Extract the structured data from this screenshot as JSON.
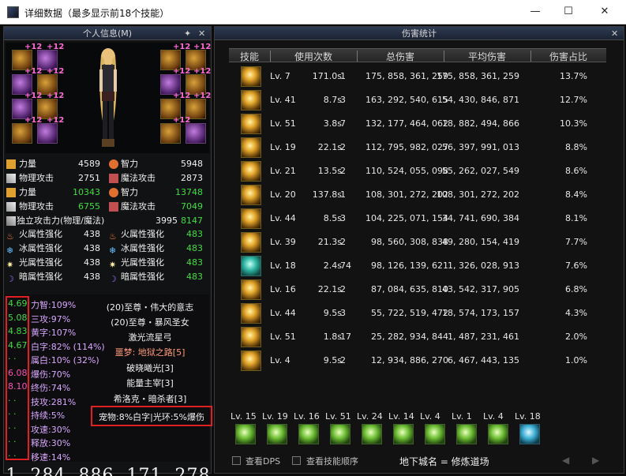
{
  "window": {
    "title": "详细数据（最多显示前18个技能）",
    "min": "—",
    "max": "☐",
    "close": "✕"
  },
  "left_panel": {
    "header": "个人信息(M)",
    "pin": "📌",
    "close": "✕",
    "equip_plus": "+12",
    "stats": [
      {
        "l1": "力量",
        "v1": "4589",
        "c1": "white",
        "l2": "智力",
        "v2": "5948",
        "c2": "white"
      },
      {
        "l1": "物理攻击",
        "v1": "2751",
        "c1": "white",
        "l2": "魔法攻击",
        "v2": "2873",
        "c2": "white"
      },
      {
        "l1": "力量",
        "v1": "10343",
        "c1": "green",
        "l2": "智力",
        "v2": "13748",
        "c2": "green"
      },
      {
        "l1": "物理攻击",
        "v1": "6755",
        "c1": "green",
        "l2": "魔法攻击",
        "v2": "7049",
        "c2": "green"
      }
    ],
    "indep": {
      "label": "独立攻击力(物理/魔法)",
      "v1": "3995",
      "v2": "8147"
    },
    "elements": [
      {
        "l1": "火属性强化",
        "v1": "438",
        "l2": "火属性强化",
        "v2": "483"
      },
      {
        "l1": "冰属性强化",
        "v1": "438",
        "l2": "冰属性强化",
        "v2": "483"
      },
      {
        "l1": "光属性强化",
        "v1": "438",
        "l2": "光属性强化",
        "v2": "483"
      },
      {
        "l1": "暗属性强化",
        "v1": "438",
        "l2": "暗属性强化",
        "v2": "483"
      }
    ],
    "buff_nums": [
      "4.69",
      "5.08",
      "4.83",
      "4.67",
      "· ·",
      "6.08",
      "8.10",
      "· ·",
      "· ·",
      "· ·",
      "· ·",
      "· ·"
    ],
    "buff_labels": [
      "力智:109%",
      "三攻:97%",
      "黄字:107%",
      "白字:82% (114%)",
      "属白:10% (32%)",
      "爆伤:70%",
      "终伤:74%",
      "技攻:281%",
      "持续:5%",
      "攻速:30%",
      "释放:30%",
      "移速:14%"
    ],
    "center_lines": [
      {
        "text": "(20)至尊・伟大的意志",
        "color": "#f0f0f0"
      },
      {
        "text": "(20)至尊・暴风圣女",
        "color": "#f0f0f0"
      },
      {
        "text": "激光流星弓",
        "color": "#f0f0f0"
      },
      {
        "text": "噩梦: 地狱之路[5]",
        "color": "#ff9a7a"
      },
      {
        "text": "破晓曦光[3]",
        "color": "#f0f0f0"
      },
      {
        "text": "能量主宰[3]",
        "color": "#f0f0f0"
      },
      {
        "text": "希洛克・暗杀者[3]",
        "color": "#f0f0f0"
      }
    ],
    "pet_line": "宠物:8%白字|光环:5%爆伤",
    "total_damage": "1, 284, 886, 171, 278"
  },
  "right_panel": {
    "header": "伤害统计",
    "close": "✕",
    "columns": [
      "技能",
      "使用次数",
      "总伤害",
      "平均伤害",
      "伤害占比"
    ],
    "rows": [
      {
        "lv": "Lv. 7",
        "time": "171.0s",
        "uses": "1",
        "total": "175, 858, 361, 259",
        "avg": "175, 858, 361, 259",
        "pct": "13.7%"
      },
      {
        "lv": "Lv. 41",
        "time": "8.7s",
        "uses": "3",
        "total": "163, 292, 540, 615",
        "avg": "54, 430, 846, 871",
        "pct": "12.7%"
      },
      {
        "lv": "Lv. 51",
        "time": "3.8s",
        "uses": "7",
        "total": "132, 177, 464, 062",
        "avg": "18, 882, 494, 866",
        "pct": "10.3%"
      },
      {
        "lv": "Lv. 19",
        "time": "22.1s",
        "uses": "2",
        "total": "112, 795, 982, 027",
        "avg": "56, 397, 991, 013",
        "pct": "8.8%"
      },
      {
        "lv": "Lv. 21",
        "time": "13.5s",
        "uses": "2",
        "total": "110, 524, 055, 098",
        "avg": "55, 262, 027, 549",
        "pct": "8.6%"
      },
      {
        "lv": "Lv. 20",
        "time": "137.8s",
        "uses": "1",
        "total": "108, 301, 272, 202",
        "avg": "108, 301, 272, 202",
        "pct": "8.4%"
      },
      {
        "lv": "Lv. 44",
        "time": "8.5s",
        "uses": "3",
        "total": "104, 225, 071, 154",
        "avg": "34, 741, 690, 384",
        "pct": "8.1%"
      },
      {
        "lv": "Lv. 39",
        "time": "21.3s",
        "uses": "2",
        "total": "98, 560, 308, 838",
        "avg": "49, 280, 154, 419",
        "pct": "7.7%"
      },
      {
        "lv": "Lv. 18",
        "time": "2.4s",
        "uses": "74",
        "total": "98, 126, 139, 621",
        "avg": "1, 326, 028, 913",
        "pct": "7.6%"
      },
      {
        "lv": "Lv. 16",
        "time": "22.1s",
        "uses": "2",
        "total": "87, 084, 635, 810",
        "avg": "43, 542, 317, 905",
        "pct": "6.8%"
      },
      {
        "lv": "Lv. 44",
        "time": "9.5s",
        "uses": "3",
        "total": "55, 722, 519, 472",
        "avg": "18, 574, 173, 157",
        "pct": "4.3%"
      },
      {
        "lv": "Lv. 51",
        "time": "1.8s",
        "uses": "17",
        "total": "25, 282, 934, 844",
        "avg": "1, 487, 231, 461",
        "pct": "2.0%"
      },
      {
        "lv": "Lv. 4",
        "time": "9.5s",
        "uses": "2",
        "total": "12, 934, 886, 270",
        "avg": "6, 467, 443, 135",
        "pct": "1.0%"
      }
    ],
    "bottom_skills": [
      "Lv. 15",
      "Lv. 19",
      "Lv. 16",
      "Lv. 51",
      "Lv. 24",
      "Lv. 14",
      "Lv. 4",
      "Lv. 1",
      "Lv. 4",
      "Lv. 18"
    ],
    "footer": {
      "show_dps": "查看DPS",
      "show_order": "查看技能顺序",
      "dungeon": "地下城名 = 修炼道场"
    }
  }
}
